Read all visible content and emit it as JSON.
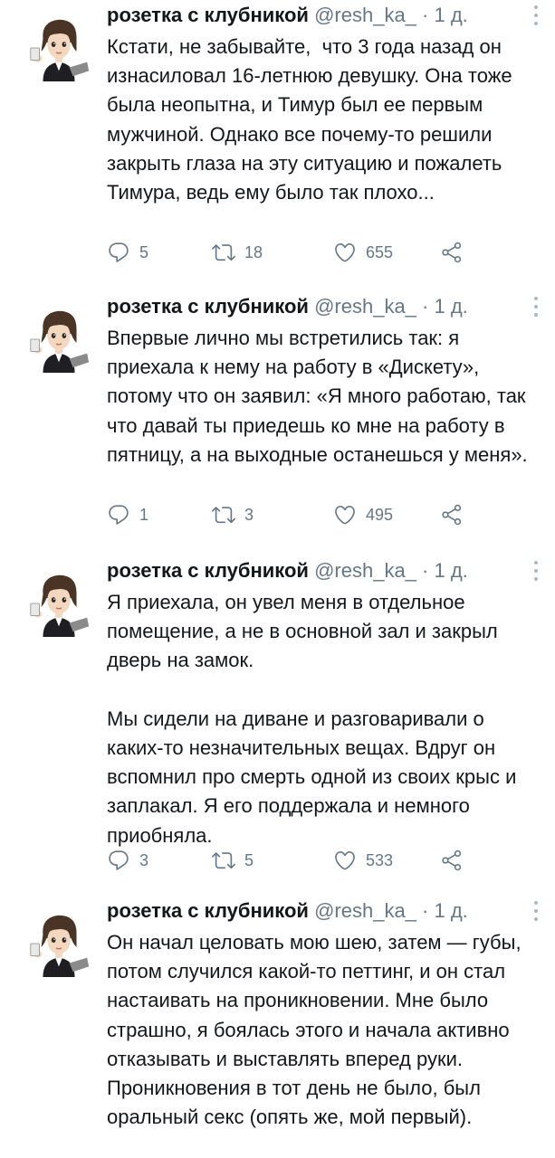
{
  "tweets": [
    {
      "name": "розетка с клубникой",
      "handle": "@resh_ka_",
      "time": "· 1 д.",
      "text": "Кстати, не забывайте,  что 3 года назад он изнасиловал 16-летнюю девушку. Она тоже была неопытна, и Тимур был ее первым мужчиной. Однако все почему-то решили закрыть глаза на эту ситуацию и пожалеть Тимура, ведь ему было так плохо...",
      "replies": "5",
      "retweets": "18",
      "likes": "655"
    },
    {
      "name": "розетка с клубникой",
      "handle": "@resh_ka_",
      "time": "· 1 д.",
      "text": "Впервые лично мы встретились так: я приехала к нему на работу в «Дискету», потому что он заявил: «Я много работаю, так что давай ты приедешь ко мне на работу в пятницу, а на выходные останешься у меня».",
      "replies": "1",
      "retweets": "3",
      "likes": "495"
    },
    {
      "name": "розетка с клубникой",
      "handle": "@resh_ka_",
      "time": "· 1 д.",
      "text": "Я приехала, он увел меня в отдельное помещение, а не в основной зал и закрыл дверь на замок.\n\nМы сидели на диване и разговаривали о каких-то незначительных вещах. Вдруг он вспомнил про смерть одной из своих крыс и заплакал. Я его поддержала и немного приобняла.",
      "replies": "3",
      "retweets": "5",
      "likes": "533"
    },
    {
      "name": "розетка с клубникой",
      "handle": "@resh_ka_",
      "time": "· 1 д.",
      "text": "Он начал целовать мою шею, затем — губы, потом случился какой-то петтинг, и он стал настаивать на проникновении. Мне было страшно, я боялась этого и начала активно отказывать и выставлять вперед руки. Проникновения в тот день не было, был оральный секс (опять же, мой первый)."
    }
  ],
  "colors": {
    "text": "#14171a",
    "secondary": "#657786",
    "divider": "#e6ecf0"
  },
  "icons": [
    "reply-icon",
    "retweet-icon",
    "like-icon",
    "share-icon",
    "more-icon",
    "avatar"
  ]
}
